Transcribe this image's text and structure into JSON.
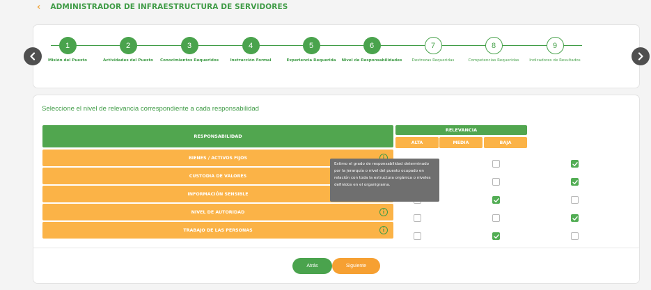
{
  "header": {
    "back_symbol": "‹",
    "title": "ADMINISTRADOR DE INFRAESTRUCTURA DE SERVIDORES"
  },
  "stepper": {
    "prev_icon": "chevron-left-icon",
    "next_icon": "chevron-right-icon",
    "steps": [
      {
        "number": "1",
        "label": "Misión del Puesto",
        "status": "done"
      },
      {
        "number": "2",
        "label": "Actividades del Puesto",
        "status": "done"
      },
      {
        "number": "3",
        "label": "Conocimientos Requeridos",
        "status": "done"
      },
      {
        "number": "4",
        "label": "Instrucción Formal",
        "status": "done"
      },
      {
        "number": "5",
        "label": "Experiencia Requerida",
        "status": "done"
      },
      {
        "number": "6",
        "label": "Nivel de Responsabilidades",
        "status": "done"
      },
      {
        "number": "7",
        "label": "Destrezas Requeridas",
        "status": "todo"
      },
      {
        "number": "8",
        "label": "Competencias Requeridas",
        "status": "todo"
      },
      {
        "number": "9",
        "label": "Indicadores de Resultados",
        "status": "todo"
      }
    ]
  },
  "main": {
    "instruction": "Seleccione el nivel de relevancia correspondiente a cada responsabilidad",
    "table": {
      "resp_header": "RESPONSABILIDAD",
      "relevance_header": "RELEVANCIA",
      "columns": [
        "ALTA",
        "MEDIA",
        "BAJA"
      ],
      "rows": [
        {
          "label": "BIENES / ACTIVOS FIJOS",
          "checks": [
            false,
            false,
            true
          ]
        },
        {
          "label": "CUSTODIA DE VALORES",
          "checks": [
            false,
            false,
            true
          ]
        },
        {
          "label": "INFORMACIÓN SENSIBLE",
          "checks": [
            false,
            true,
            false
          ]
        },
        {
          "label": "NIVEL DE AUTORIDAD",
          "checks": [
            false,
            false,
            true
          ]
        },
        {
          "label": "TRABAJO DE LAS PERSONAS",
          "checks": [
            false,
            true,
            false
          ]
        }
      ]
    },
    "tooltip": "Estimo el grado de responsabilidad determinado por la jerarquía o nivel del puesto ocupado en relación con toda la estructura orgánica o niveles definidos en el organigrama.",
    "info_symbol": "i"
  },
  "footer": {
    "back_label": "Atrás",
    "next_label": "Siguiente"
  },
  "colors": {
    "green": "#4aa34d",
    "orange": "#fbb347",
    "next_button": "#f6a032",
    "tooltip_bg": "#6f6f6f"
  }
}
